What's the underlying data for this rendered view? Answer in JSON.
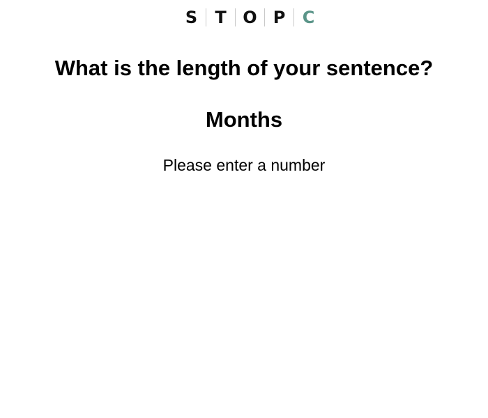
{
  "logo": {
    "letters": [
      "S",
      "T",
      "O",
      "P",
      "C"
    ],
    "accent_color": "#5b9589"
  },
  "question": {
    "title": "What is the length of your sentence?",
    "unit": "Months",
    "hint": "Please enter a number"
  }
}
